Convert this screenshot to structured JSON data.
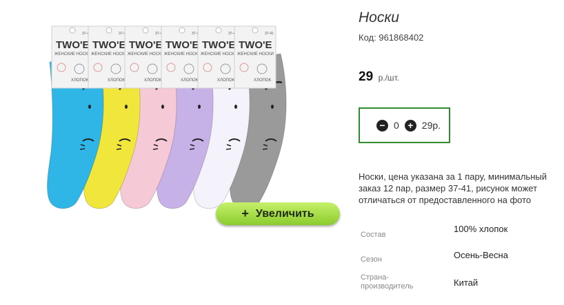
{
  "product": {
    "title": "Носки",
    "code_label": "Код:",
    "code_value": "961868402",
    "price_value": "29",
    "price_unit": "р./шт.",
    "quantity": "0",
    "line_total": "29р.",
    "description": "Носки, цена указана за 1 пару, минимальный заказ 12 пар, размер 37-41, рисунок может отличаться от предоставленного на фото"
  },
  "image": {
    "brand": "TWO'E",
    "card_subtitle": "ЖЕНСКИЕ НОСКИ",
    "card_size": "37-41",
    "card_material": "ХЛОПОК",
    "sock_colors": [
      "#2fb6e6",
      "#f0e63c",
      "#f6c9d6",
      "#c7b2e8",
      "#f4f2fa",
      "#9a9a9a"
    ]
  },
  "zoom_button": {
    "label": "Увеличить",
    "icon": "plus-icon"
  },
  "specs": [
    {
      "label": "Состав",
      "value": "100% хлопок"
    },
    {
      "label": "Сезон",
      "value": "Осень-Весна"
    },
    {
      "label": "Страна-производитель",
      "value": "Китай"
    }
  ],
  "colors": {
    "accent_border": "#2e8b2e",
    "button_green": "#8bcc2e"
  }
}
